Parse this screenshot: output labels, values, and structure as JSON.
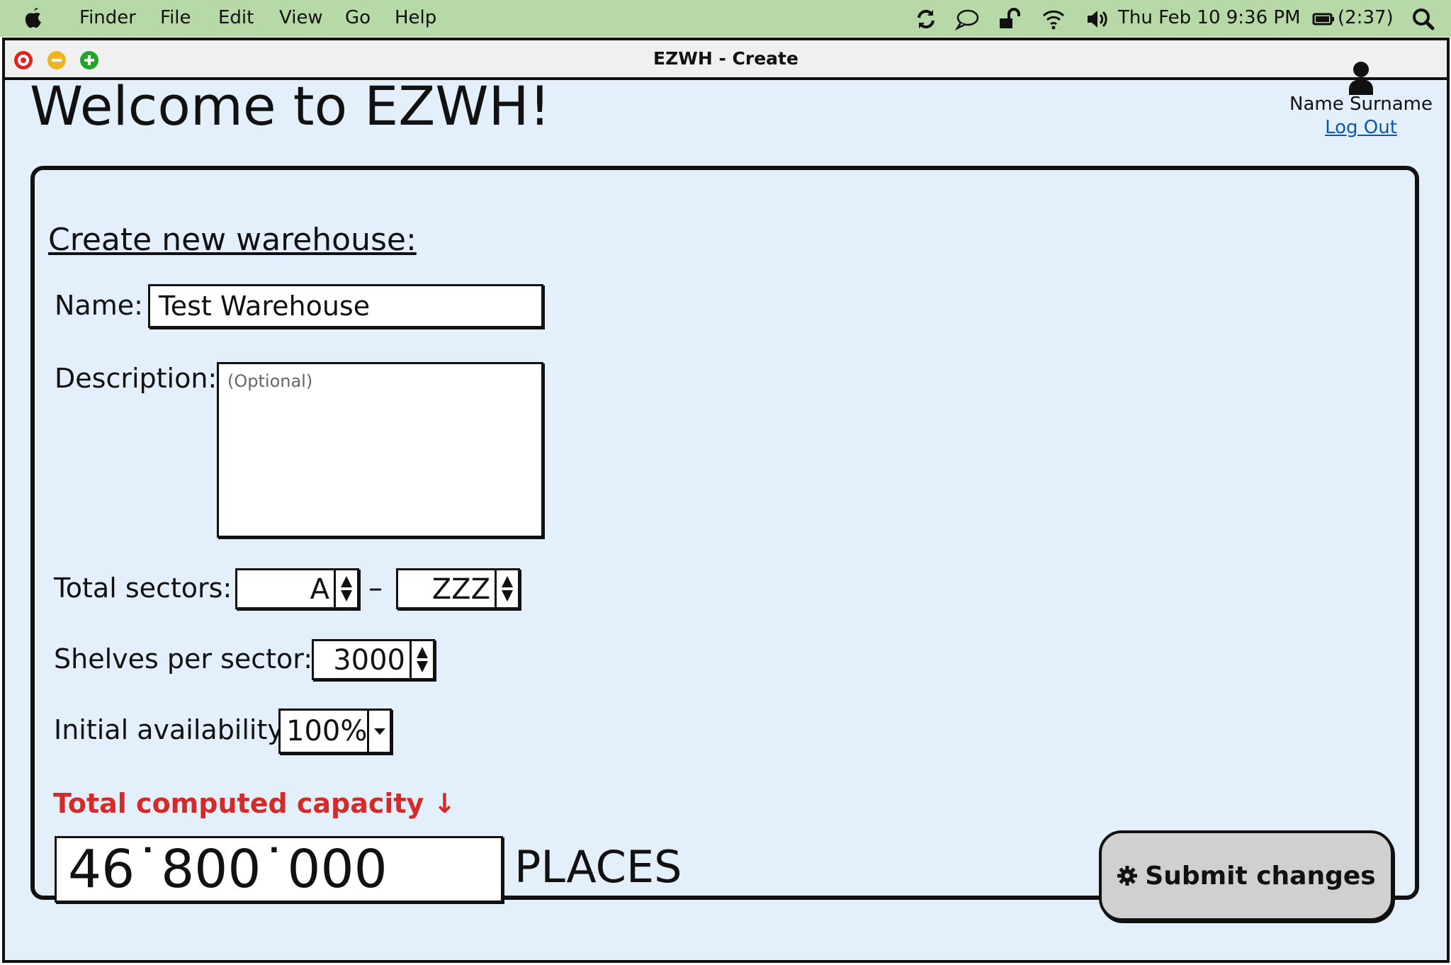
{
  "menubar": {
    "items": [
      "Finder",
      "File",
      "Edit",
      "View",
      "Go",
      "Help"
    ],
    "clock": "Thu Feb 10  9:36 PM",
    "battery": "(2:37)",
    "background_color": "#b7d8a7"
  },
  "window": {
    "title": "EZWH - Create",
    "background_color": "#e3effb"
  },
  "header": {
    "welcome": "Welcome to EZWH!",
    "user_name": "Name Surname",
    "logout": "Log Out"
  },
  "form": {
    "heading": "Create new warehouse:",
    "name_label": "Name:",
    "name_value": "Test Warehouse",
    "description_label": "Description:",
    "description_placeholder": "(Optional)",
    "sectors_label": "Total sectors:",
    "sector_from": "A",
    "sector_separator": "–",
    "sector_to": "ZZZ",
    "shelves_label": "Shelves per sector:",
    "shelves_value": "3000",
    "availability_label": "Initial availability:",
    "availability_value": "100%",
    "capacity_label": "Total computed capacity ↓",
    "capacity_value": "46˙800˙000",
    "capacity_unit": "PLACES",
    "submit_label": "Submit changes",
    "capacity_color": "#d42a2a"
  }
}
